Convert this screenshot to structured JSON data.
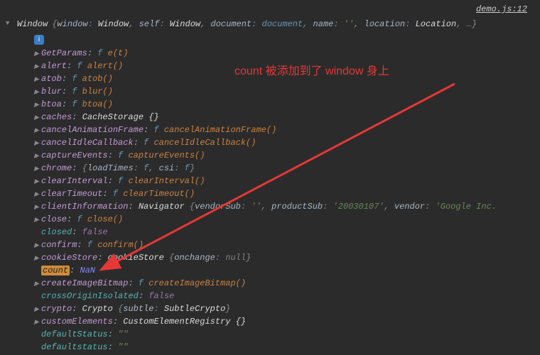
{
  "sourceLink": "demo.js:12",
  "headerPrefix": "Window",
  "headerParts": {
    "windowK": "window",
    "windowV": "Window",
    "selfK": "self",
    "selfV": "Window",
    "documentK": "document",
    "documentV": "document",
    "nameK": "name",
    "nameV": "''",
    "locationK": "location",
    "locationV": "Location",
    "ellipsis": "…"
  },
  "annotation": "count 被添加到了 window 身上",
  "rowsContent": {
    "getParams": {
      "key": "GetParams",
      "sig": "e(t)"
    },
    "alert": {
      "key": "alert",
      "sig": "alert()"
    },
    "atob": {
      "key": "atob",
      "sig": "atob()"
    },
    "blur": {
      "key": "blur",
      "sig": "blur()"
    },
    "btoa": {
      "key": "btoa",
      "sig": "btoa()"
    },
    "caches": {
      "key": "caches",
      "rest": "CacheStorage {}"
    },
    "cancelAnimationFrame": {
      "key": "cancelAnimationFrame",
      "sig": "cancelAnimationFrame()"
    },
    "cancelIdleCallback": {
      "key": "cancelIdleCallback",
      "sig": "cancelIdleCallback()"
    },
    "captureEvents": {
      "key": "captureEvents",
      "sig": "captureEvents()"
    },
    "chrome": {
      "key": "chrome",
      "loadTimesK": "loadTimes",
      "csiK": "csi"
    },
    "clearInterval": {
      "key": "clearInterval",
      "sig": "clearInterval()"
    },
    "clearTimeout": {
      "key": "clearTimeout",
      "sig": "clearTimeout()"
    },
    "clientInformation": {
      "key": "clientInformation",
      "navigator": "Navigator",
      "vendorSubK": "vendorSub",
      "vendorSubV": "''",
      "productSubK": "productSub",
      "productSubV": "'20030107'",
      "vendorK": "vendor",
      "vendorV": "'Google Inc."
    },
    "close": {
      "key": "close",
      "sig": "close()"
    },
    "closed": {
      "key": "closed",
      "val": "false"
    },
    "confirm": {
      "key": "confirm",
      "sig": "confirm()"
    },
    "cookieStore": {
      "key": "cookieStore",
      "cls": "cookieStore",
      "onchangeK": "onchange",
      "onchangeV": "null"
    },
    "count": {
      "key": "count",
      "val": "NaN"
    },
    "createImageBitmap": {
      "key": "createImageBitmap",
      "sig": "createImageBitmap()"
    },
    "crossOriginIsolated": {
      "key": "crossOriginIsolated",
      "val": "false"
    },
    "crypto": {
      "key": "crypto",
      "cls": "Crypto",
      "subtleK": "subtle",
      "subtleV": "SubtleCrypto"
    },
    "customElements": {
      "key": "customElements",
      "rest": "CustomElementRegistry {}"
    },
    "defaultStatus": {
      "key": "defaultStatus",
      "val": "\"\""
    },
    "defaultstatus": {
      "key": "defaultstatus",
      "val": "\"\""
    }
  },
  "fLabel": "f"
}
